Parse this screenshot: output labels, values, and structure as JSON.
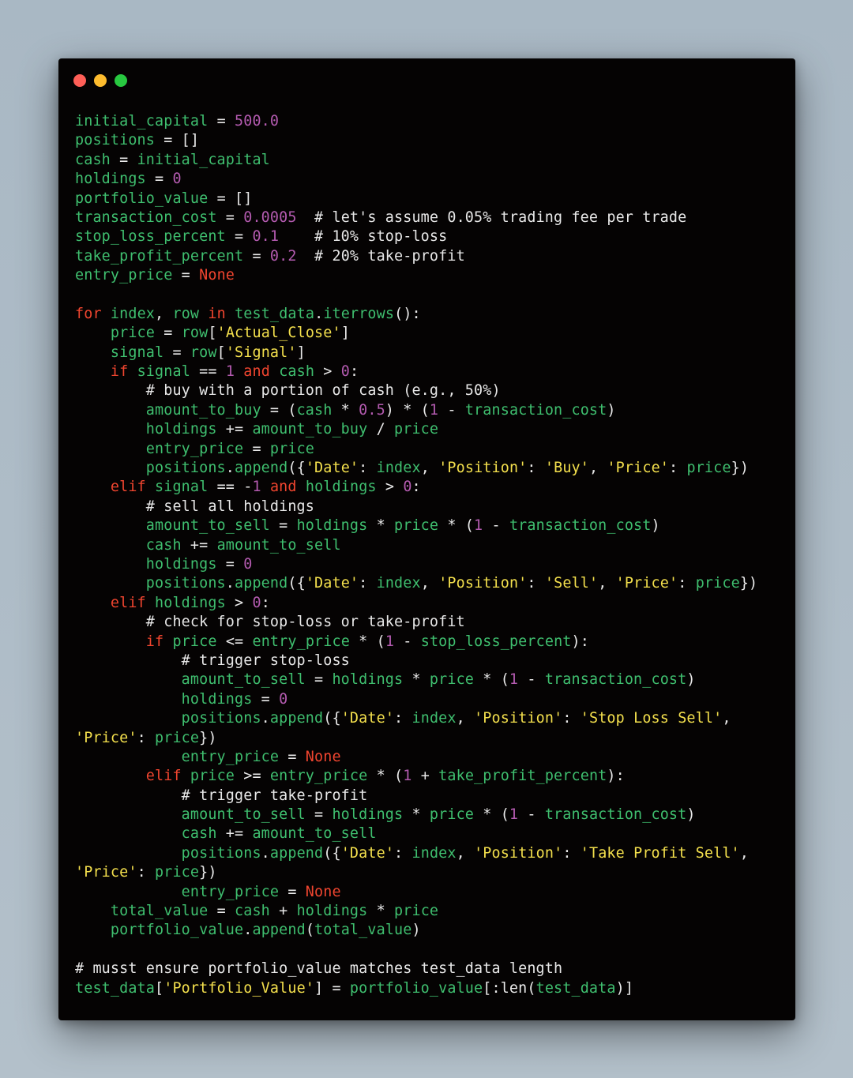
{
  "colors": {
    "background": "#b3c0ca",
    "window": "#050303",
    "red": "#ff5f57",
    "yellow": "#febc2e",
    "green": "#28c840",
    "variable": "#3fbf6f",
    "number": "#b45bb0",
    "string": "#f4e04d",
    "keyword": "#f0452f",
    "comment": "#e8e8e8"
  },
  "window_controls": [
    "close-dot",
    "minimize-dot",
    "maximize-dot"
  ],
  "code_lines": [
    [
      [
        "var",
        "initial_capital"
      ],
      [
        "op",
        " = "
      ],
      [
        "num",
        "500.0"
      ]
    ],
    [
      [
        "var",
        "positions"
      ],
      [
        "op",
        " = []"
      ]
    ],
    [
      [
        "var",
        "cash"
      ],
      [
        "op",
        " = "
      ],
      [
        "var",
        "initial_capital"
      ]
    ],
    [
      [
        "var",
        "holdings"
      ],
      [
        "op",
        " = "
      ],
      [
        "num",
        "0"
      ]
    ],
    [
      [
        "var",
        "portfolio_value"
      ],
      [
        "op",
        " = []"
      ]
    ],
    [
      [
        "var",
        "transaction_cost"
      ],
      [
        "op",
        " = "
      ],
      [
        "num",
        "0.0005"
      ],
      [
        "cm",
        "  # let's assume 0.05% trading fee per trade"
      ]
    ],
    [
      [
        "var",
        "stop_loss_percent"
      ],
      [
        "op",
        " = "
      ],
      [
        "num",
        "0.1"
      ],
      [
        "cm",
        "    # 10% stop-loss"
      ]
    ],
    [
      [
        "var",
        "take_profit_percent"
      ],
      [
        "op",
        " = "
      ],
      [
        "num",
        "0.2"
      ],
      [
        "cm",
        "  # 20% take-profit"
      ]
    ],
    [
      [
        "var",
        "entry_price"
      ],
      [
        "op",
        " = "
      ],
      [
        "kw",
        "None"
      ]
    ],
    [],
    [
      [
        "kw",
        "for"
      ],
      [
        "op",
        " "
      ],
      [
        "var",
        "index"
      ],
      [
        "op",
        ", "
      ],
      [
        "var",
        "row"
      ],
      [
        "op",
        " "
      ],
      [
        "kw",
        "in"
      ],
      [
        "op",
        " "
      ],
      [
        "var",
        "test_data"
      ],
      [
        "op",
        "."
      ],
      [
        "var",
        "iterrows"
      ],
      [
        "op",
        "():"
      ]
    ],
    [
      [
        "op",
        "    "
      ],
      [
        "var",
        "price"
      ],
      [
        "op",
        " = "
      ],
      [
        "var",
        "row"
      ],
      [
        "op",
        "["
      ],
      [
        "str",
        "'Actual_Close'"
      ],
      [
        "op",
        "]"
      ]
    ],
    [
      [
        "op",
        "    "
      ],
      [
        "var",
        "signal"
      ],
      [
        "op",
        " = "
      ],
      [
        "var",
        "row"
      ],
      [
        "op",
        "["
      ],
      [
        "str",
        "'Signal'"
      ],
      [
        "op",
        "]"
      ]
    ],
    [
      [
        "op",
        "    "
      ],
      [
        "kw",
        "if"
      ],
      [
        "op",
        " "
      ],
      [
        "var",
        "signal"
      ],
      [
        "op",
        " == "
      ],
      [
        "num",
        "1"
      ],
      [
        "op",
        " "
      ],
      [
        "kw",
        "and"
      ],
      [
        "op",
        " "
      ],
      [
        "var",
        "cash"
      ],
      [
        "op",
        " > "
      ],
      [
        "num",
        "0"
      ],
      [
        "op",
        ":"
      ]
    ],
    [
      [
        "cm",
        "        # buy with a portion of cash (e.g., 50%)"
      ]
    ],
    [
      [
        "op",
        "        "
      ],
      [
        "var",
        "amount_to_buy"
      ],
      [
        "op",
        " = ("
      ],
      [
        "var",
        "cash"
      ],
      [
        "op",
        " * "
      ],
      [
        "num",
        "0.5"
      ],
      [
        "op",
        ") * ("
      ],
      [
        "num",
        "1"
      ],
      [
        "op",
        " - "
      ],
      [
        "var",
        "transaction_cost"
      ],
      [
        "op",
        ")"
      ]
    ],
    [
      [
        "op",
        "        "
      ],
      [
        "var",
        "holdings"
      ],
      [
        "op",
        " += "
      ],
      [
        "var",
        "amount_to_buy"
      ],
      [
        "op",
        " / "
      ],
      [
        "var",
        "price"
      ]
    ],
    [
      [
        "op",
        "        "
      ],
      [
        "var",
        "entry_price"
      ],
      [
        "op",
        " = "
      ],
      [
        "var",
        "price"
      ]
    ],
    [
      [
        "op",
        "        "
      ],
      [
        "var",
        "positions"
      ],
      [
        "op",
        "."
      ],
      [
        "var",
        "append"
      ],
      [
        "op",
        "({"
      ],
      [
        "str",
        "'Date'"
      ],
      [
        "op",
        ": "
      ],
      [
        "var",
        "index"
      ],
      [
        "op",
        ", "
      ],
      [
        "str",
        "'Position'"
      ],
      [
        "op",
        ": "
      ],
      [
        "str",
        "'Buy'"
      ],
      [
        "op",
        ", "
      ],
      [
        "str",
        "'Price'"
      ],
      [
        "op",
        ": "
      ],
      [
        "var",
        "price"
      ],
      [
        "op",
        "})"
      ]
    ],
    [
      [
        "op",
        "    "
      ],
      [
        "kw",
        "elif"
      ],
      [
        "op",
        " "
      ],
      [
        "var",
        "signal"
      ],
      [
        "op",
        " == -"
      ],
      [
        "num",
        "1"
      ],
      [
        "op",
        " "
      ],
      [
        "kw",
        "and"
      ],
      [
        "op",
        " "
      ],
      [
        "var",
        "holdings"
      ],
      [
        "op",
        " > "
      ],
      [
        "num",
        "0"
      ],
      [
        "op",
        ":"
      ]
    ],
    [
      [
        "cm",
        "        # sell all holdings"
      ]
    ],
    [
      [
        "op",
        "        "
      ],
      [
        "var",
        "amount_to_sell"
      ],
      [
        "op",
        " = "
      ],
      [
        "var",
        "holdings"
      ],
      [
        "op",
        " * "
      ],
      [
        "var",
        "price"
      ],
      [
        "op",
        " * ("
      ],
      [
        "num",
        "1"
      ],
      [
        "op",
        " - "
      ],
      [
        "var",
        "transaction_cost"
      ],
      [
        "op",
        ")"
      ]
    ],
    [
      [
        "op",
        "        "
      ],
      [
        "var",
        "cash"
      ],
      [
        "op",
        " += "
      ],
      [
        "var",
        "amount_to_sell"
      ]
    ],
    [
      [
        "op",
        "        "
      ],
      [
        "var",
        "holdings"
      ],
      [
        "op",
        " = "
      ],
      [
        "num",
        "0"
      ]
    ],
    [
      [
        "op",
        "        "
      ],
      [
        "var",
        "positions"
      ],
      [
        "op",
        "."
      ],
      [
        "var",
        "append"
      ],
      [
        "op",
        "({"
      ],
      [
        "str",
        "'Date'"
      ],
      [
        "op",
        ": "
      ],
      [
        "var",
        "index"
      ],
      [
        "op",
        ", "
      ],
      [
        "str",
        "'Position'"
      ],
      [
        "op",
        ": "
      ],
      [
        "str",
        "'Sell'"
      ],
      [
        "op",
        ", "
      ],
      [
        "str",
        "'Price'"
      ],
      [
        "op",
        ": "
      ],
      [
        "var",
        "price"
      ],
      [
        "op",
        "})"
      ]
    ],
    [
      [
        "op",
        "    "
      ],
      [
        "kw",
        "elif"
      ],
      [
        "op",
        " "
      ],
      [
        "var",
        "holdings"
      ],
      [
        "op",
        " > "
      ],
      [
        "num",
        "0"
      ],
      [
        "op",
        ":"
      ]
    ],
    [
      [
        "cm",
        "        # check for stop-loss or take-profit"
      ]
    ],
    [
      [
        "op",
        "        "
      ],
      [
        "kw",
        "if"
      ],
      [
        "op",
        " "
      ],
      [
        "var",
        "price"
      ],
      [
        "op",
        " <= "
      ],
      [
        "var",
        "entry_price"
      ],
      [
        "op",
        " * ("
      ],
      [
        "num",
        "1"
      ],
      [
        "op",
        " - "
      ],
      [
        "var",
        "stop_loss_percent"
      ],
      [
        "op",
        "):"
      ]
    ],
    [
      [
        "cm",
        "            # trigger stop-loss"
      ]
    ],
    [
      [
        "op",
        "            "
      ],
      [
        "var",
        "amount_to_sell"
      ],
      [
        "op",
        " = "
      ],
      [
        "var",
        "holdings"
      ],
      [
        "op",
        " * "
      ],
      [
        "var",
        "price"
      ],
      [
        "op",
        " * ("
      ],
      [
        "num",
        "1"
      ],
      [
        "op",
        " - "
      ],
      [
        "var",
        "transaction_cost"
      ],
      [
        "op",
        ")"
      ]
    ],
    [
      [
        "op",
        "            "
      ],
      [
        "var",
        "holdings"
      ],
      [
        "op",
        " = "
      ],
      [
        "num",
        "0"
      ]
    ],
    [
      [
        "op",
        "            "
      ],
      [
        "var",
        "positions"
      ],
      [
        "op",
        "."
      ],
      [
        "var",
        "append"
      ],
      [
        "op",
        "({"
      ],
      [
        "str",
        "'Date'"
      ],
      [
        "op",
        ": "
      ],
      [
        "var",
        "index"
      ],
      [
        "op",
        ", "
      ],
      [
        "str",
        "'Position'"
      ],
      [
        "op",
        ": "
      ],
      [
        "str",
        "'Stop Loss Sell'"
      ],
      [
        "op",
        ","
      ]
    ],
    [
      [
        "str",
        "'Price'"
      ],
      [
        "op",
        ": "
      ],
      [
        "var",
        "price"
      ],
      [
        "op",
        "})"
      ]
    ],
    [
      [
        "op",
        "            "
      ],
      [
        "var",
        "entry_price"
      ],
      [
        "op",
        " = "
      ],
      [
        "kw",
        "None"
      ]
    ],
    [
      [
        "op",
        "        "
      ],
      [
        "kw",
        "elif"
      ],
      [
        "op",
        " "
      ],
      [
        "var",
        "price"
      ],
      [
        "op",
        " >= "
      ],
      [
        "var",
        "entry_price"
      ],
      [
        "op",
        " * ("
      ],
      [
        "num",
        "1"
      ],
      [
        "op",
        " + "
      ],
      [
        "var",
        "take_profit_percent"
      ],
      [
        "op",
        "):"
      ]
    ],
    [
      [
        "cm",
        "            # trigger take-profit"
      ]
    ],
    [
      [
        "op",
        "            "
      ],
      [
        "var",
        "amount_to_sell"
      ],
      [
        "op",
        " = "
      ],
      [
        "var",
        "holdings"
      ],
      [
        "op",
        " * "
      ],
      [
        "var",
        "price"
      ],
      [
        "op",
        " * ("
      ],
      [
        "num",
        "1"
      ],
      [
        "op",
        " - "
      ],
      [
        "var",
        "transaction_cost"
      ],
      [
        "op",
        ")"
      ]
    ],
    [
      [
        "op",
        "            "
      ],
      [
        "var",
        "cash"
      ],
      [
        "op",
        " += "
      ],
      [
        "var",
        "amount_to_sell"
      ]
    ],
    [
      [
        "op",
        "            "
      ],
      [
        "var",
        "positions"
      ],
      [
        "op",
        "."
      ],
      [
        "var",
        "append"
      ],
      [
        "op",
        "({"
      ],
      [
        "str",
        "'Date'"
      ],
      [
        "op",
        ": "
      ],
      [
        "var",
        "index"
      ],
      [
        "op",
        ", "
      ],
      [
        "str",
        "'Position'"
      ],
      [
        "op",
        ": "
      ],
      [
        "str",
        "'Take Profit Sell'"
      ],
      [
        "op",
        ","
      ]
    ],
    [
      [
        "str",
        "'Price'"
      ],
      [
        "op",
        ": "
      ],
      [
        "var",
        "price"
      ],
      [
        "op",
        "})"
      ]
    ],
    [
      [
        "op",
        "            "
      ],
      [
        "var",
        "entry_price"
      ],
      [
        "op",
        " = "
      ],
      [
        "kw",
        "None"
      ]
    ],
    [
      [
        "op",
        "    "
      ],
      [
        "var",
        "total_value"
      ],
      [
        "op",
        " = "
      ],
      [
        "var",
        "cash"
      ],
      [
        "op",
        " + "
      ],
      [
        "var",
        "holdings"
      ],
      [
        "op",
        " * "
      ],
      [
        "var",
        "price"
      ]
    ],
    [
      [
        "op",
        "    "
      ],
      [
        "var",
        "portfolio_value"
      ],
      [
        "op",
        "."
      ],
      [
        "var",
        "append"
      ],
      [
        "op",
        "("
      ],
      [
        "var",
        "total_value"
      ],
      [
        "op",
        ")"
      ]
    ],
    [],
    [
      [
        "cm",
        "# musst ensure portfolio_value matches test_data length"
      ]
    ],
    [
      [
        "var",
        "test_data"
      ],
      [
        "op",
        "["
      ],
      [
        "str",
        "'Portfolio_Value'"
      ],
      [
        "op",
        "] = "
      ],
      [
        "var",
        "portfolio_value"
      ],
      [
        "op",
        "[:len("
      ],
      [
        "var",
        "test_data"
      ],
      [
        "op",
        ")]"
      ]
    ]
  ]
}
